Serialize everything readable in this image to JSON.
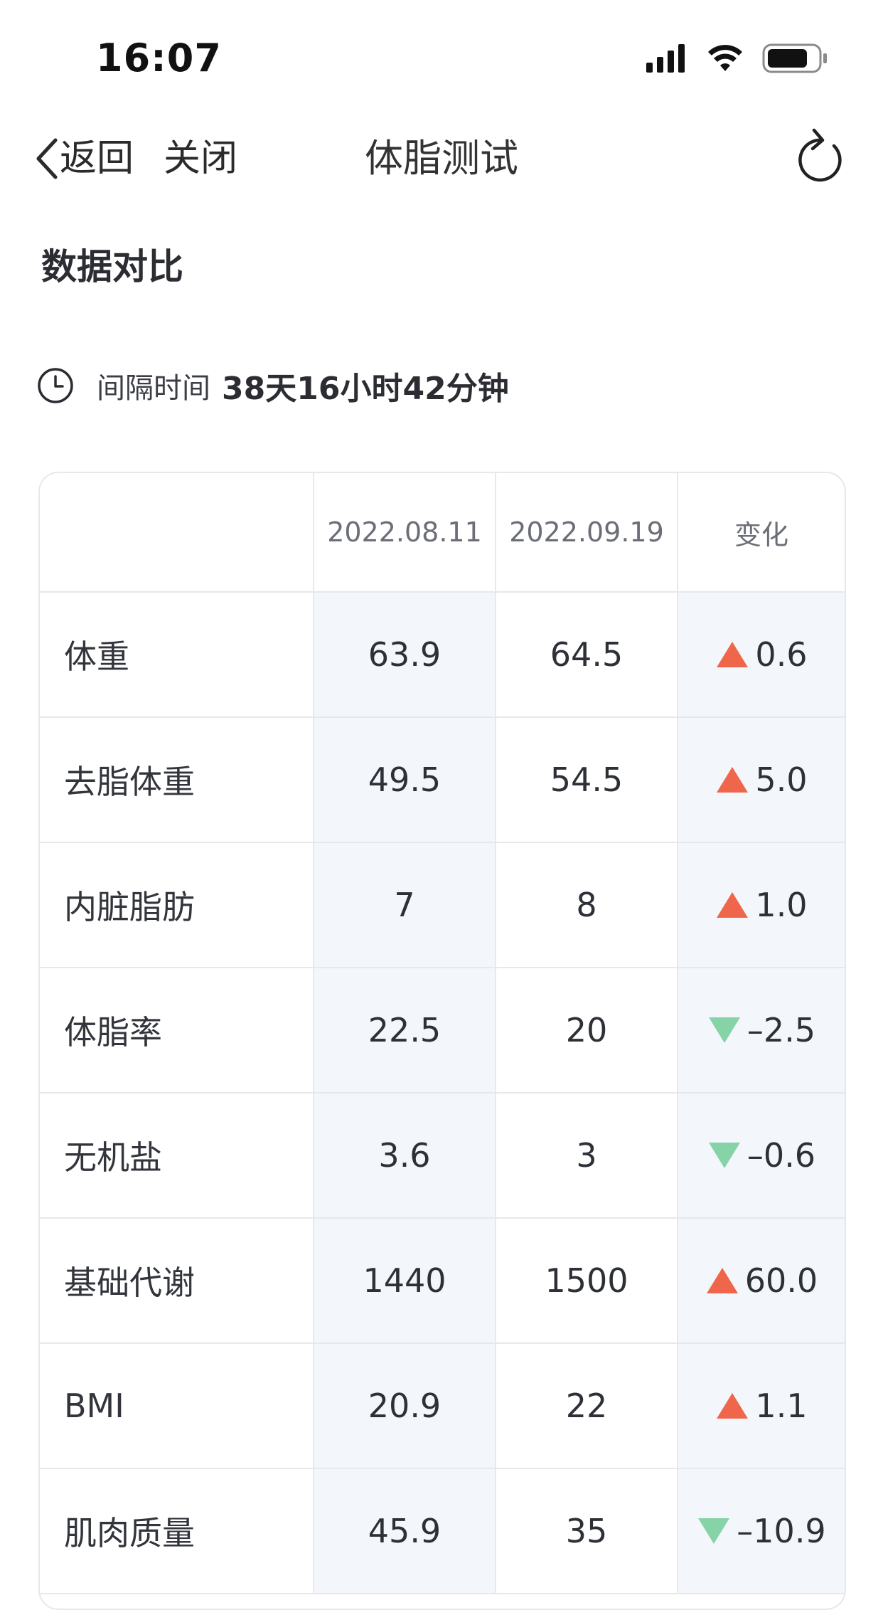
{
  "status_bar": {
    "time": "16:07",
    "icons": [
      "signal-icon",
      "wifi-icon",
      "battery-icon"
    ]
  },
  "nav": {
    "back_label": "返回",
    "close_label": "关闭",
    "title": "体脂测试",
    "refresh_icon": "refresh-icon"
  },
  "section": {
    "title": "数据对比"
  },
  "interval": {
    "icon": "clock-icon",
    "label": "间隔时间",
    "value": "38天16小时42分钟"
  },
  "table": {
    "headers": [
      "",
      "2022.08.11",
      "2022.09.19",
      "变化"
    ],
    "rows": [
      {
        "name": "体重",
        "v1": "63.9",
        "v2": "64.5",
        "change": "0.6",
        "direction": "up"
      },
      {
        "name": "去脂体重",
        "v1": "49.5",
        "v2": "54.5",
        "change": "5.0",
        "direction": "up"
      },
      {
        "name": "内脏脂肪",
        "v1": "7",
        "v2": "8",
        "change": "1.0",
        "direction": "up"
      },
      {
        "name": "体脂率",
        "v1": "22.5",
        "v2": "20",
        "change": "–2.5",
        "direction": "down"
      },
      {
        "name": "无机盐",
        "v1": "3.6",
        "v2": "3",
        "change": "–0.6",
        "direction": "down"
      },
      {
        "name": "基础代谢",
        "v1": "1440",
        "v2": "1500",
        "change": "60.0",
        "direction": "up"
      },
      {
        "name": "BMI",
        "v1": "20.9",
        "v2": "22",
        "change": "1.1",
        "direction": "up"
      },
      {
        "name": "肌肉质量",
        "v1": "45.9",
        "v2": "35",
        "change": "–10.9",
        "direction": "down"
      }
    ]
  },
  "colors": {
    "up": "#f0664b",
    "down": "#86d3a8",
    "border": "#e6e8ee",
    "stripe": "#f3f6fb"
  }
}
